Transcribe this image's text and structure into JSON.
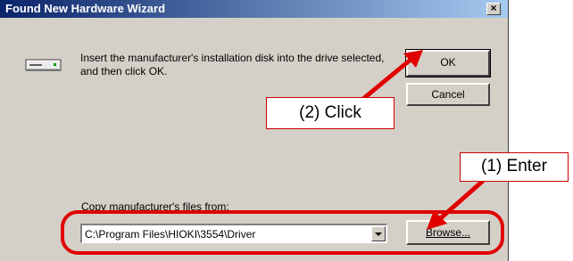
{
  "window": {
    "title": "Found New Hardware Wizard",
    "close_glyph": "×"
  },
  "message": "Insert the manufacturer's installation disk into the drive selected, and then click OK.",
  "buttons": {
    "ok_label": "OK",
    "cancel_label": "Cancel",
    "browse_label": "Browse..."
  },
  "copy_from": {
    "label": "Copy manufacturer's files from:",
    "value": "C:\\Program Files\\HIOKI\\3554\\Driver"
  },
  "annotations": {
    "click_label": "(2) Click",
    "enter_label": "(1) Enter",
    "color": "#e00000"
  },
  "icons": [
    "drive-icon",
    "close-icon",
    "chevron-down-icon"
  ]
}
